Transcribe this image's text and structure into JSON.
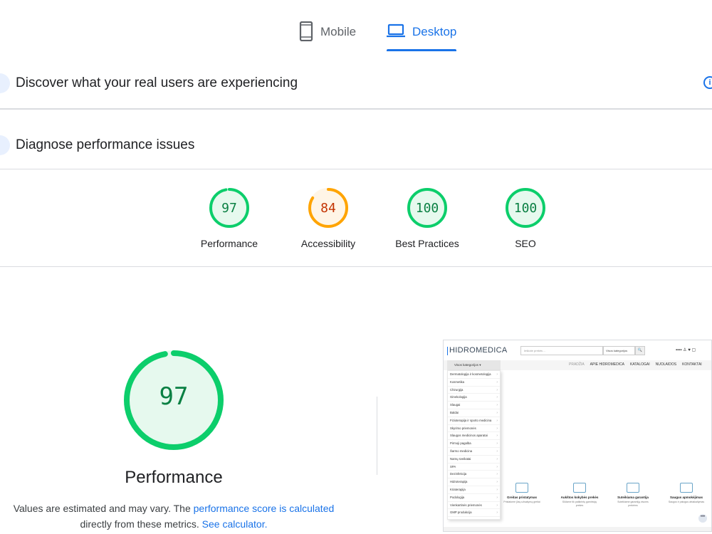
{
  "tabs": {
    "mobile_label": "Mobile",
    "desktop_label": "Desktop",
    "active": "Desktop"
  },
  "sections": {
    "real_users_title": "Discover what your real users are experiencing",
    "diagnose_title": "Diagnose performance issues"
  },
  "scores": [
    {
      "label": "Performance",
      "value": "97",
      "color": "#0cce6b",
      "text_color": "#0a8043",
      "bg": "#e6f9ee"
    },
    {
      "label": "Accessibility",
      "value": "84",
      "color": "#ffa400",
      "text_color": "#c33300",
      "bg": "#fff5e6"
    },
    {
      "label": "Best Practices",
      "value": "100",
      "color": "#0cce6b",
      "text_color": "#0a8043",
      "bg": "#e6f9ee"
    },
    {
      "label": "SEO",
      "value": "100",
      "color": "#0cce6b",
      "text_color": "#0a8043",
      "bg": "#e6f9ee"
    }
  ],
  "performance": {
    "value": "97",
    "title": "Performance",
    "desc_pre": "Values are estimated and may vary. The ",
    "desc_link1": "performance score is calculated",
    "desc_mid": "directly from these metrics. ",
    "desc_link2": "See calculator."
  },
  "thumbnail": {
    "logo": "HIDROMEDICA",
    "search_placeholder": "Ieškote prekės ...",
    "category_select": "Visos kategorijos",
    "menu_head": "Visos kategorijos",
    "nav": [
      "PRADŽIA",
      "APIE HIDROMEDICA",
      "KATALOGAI",
      "NUOLAIDOS",
      "KONTAKTAI"
    ],
    "categories": [
      "Dermatologija ir kosmetologija",
      "Kosmetika",
      "Chirurgija",
      "Ginekologija",
      "Slaugai",
      "Baldai",
      "Fizioterapija ir sporto medicina",
      "Skyrimo priemonės",
      "Slaugos medicinos aparatai",
      "Pirmoji pagalba",
      "Šarmo medicina",
      "Namų sveikatai",
      "SPA",
      "Dezinfekcija",
      "Hidroterapija",
      "Kriaterapija",
      "Podologija",
      "Vienkartinės priemonės",
      "GMP produkcija"
    ],
    "features": [
      {
        "title": "Greitas pristatymas",
        "desc": "Pristatome jūsų užsakymą greitai"
      },
      {
        "title": "Aukštos kokybės prekės",
        "desc": "Siūlome tik patikrintų gamintojų prekes"
      },
      {
        "title": "Suteikiama garantija",
        "desc": "Suteikiame garantiją visoms prekėms"
      },
      {
        "title": "Saugus apmokėjimas",
        "desc": "Saugus ir patogus atsiskaitymas"
      }
    ]
  }
}
